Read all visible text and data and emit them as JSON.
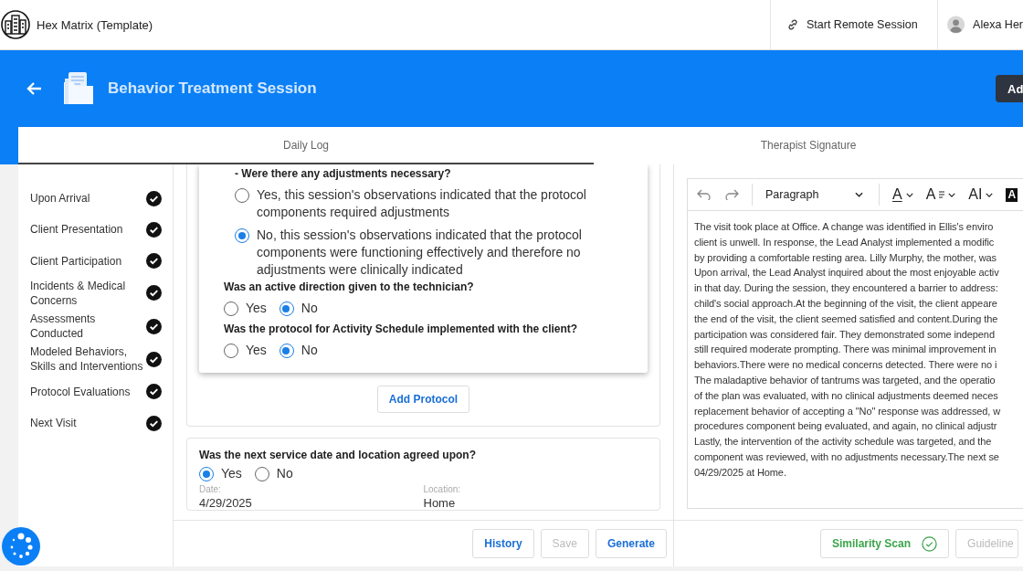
{
  "header": {
    "app_title": "Hex Matrix (Template)",
    "remote_session": "Start Remote Session",
    "user_name": "Alexa Her"
  },
  "banner": {
    "title": "Behavior Treatment Session",
    "action_button": "Ad"
  },
  "tabs": [
    {
      "label": "Daily Log",
      "selected": true
    },
    {
      "label": "Therapist Signature",
      "selected": false
    }
  ],
  "sidebar": {
    "items": [
      {
        "label": "Upon Arrival",
        "complete": true
      },
      {
        "label": "Client Presentation",
        "complete": true
      },
      {
        "label": "Client Participation",
        "complete": true
      },
      {
        "label": "Incidents & Medical Concerns",
        "complete": true
      },
      {
        "label": "Assessments Conducted",
        "complete": true
      },
      {
        "label": "Modeled Behaviors, Skills and Interventions",
        "complete": true
      },
      {
        "label": "Protocol Evaluations",
        "complete": true
      },
      {
        "label": "Next Visit",
        "complete": true
      }
    ]
  },
  "protocol_questions": [
    {
      "kind": "stacked",
      "text": "- Were there any adjustments necessary?",
      "options": [
        {
          "label": "Yes, this session's observations indicated that the protocol components required adjustments",
          "selected": false
        },
        {
          "label": "No, this session's observations indicated that the protocol components were functioning effectively and therefore no adjustments were clinically indicated",
          "selected": true
        }
      ]
    },
    {
      "kind": "inline",
      "text": "Was an active direction given to the technician?",
      "options": [
        {
          "label": "Yes",
          "selected": false
        },
        {
          "label": "No",
          "selected": true
        }
      ]
    },
    {
      "kind": "inline",
      "text": "Was the protocol for Activity Schedule implemented with the client?",
      "options": [
        {
          "label": "Yes",
          "selected": false
        },
        {
          "label": "No",
          "selected": true
        }
      ]
    }
  ],
  "add_protocol_button": "Add Protocol",
  "next_visit": {
    "question": "Was the next service date and location agreed upon?",
    "options": [
      {
        "label": "Yes",
        "selected": true
      },
      {
        "label": "No",
        "selected": false
      }
    ],
    "date_label": "Date:",
    "date_value": "4/29/2025",
    "location_label": "Location:",
    "location_value": "Home"
  },
  "action_buttons": [
    {
      "label": "History",
      "disabled": false
    },
    {
      "label": "Save",
      "disabled": true
    },
    {
      "label": "Generate",
      "disabled": false
    }
  ],
  "editor": {
    "block_format": "Paragraph",
    "format_buttons": [
      {
        "kind": "font-color",
        "glyph": "A"
      },
      {
        "kind": "font-size",
        "glyph": "A"
      },
      {
        "kind": "font-family",
        "glyph": "AI"
      },
      {
        "kind": "highlight",
        "glyph": "A"
      }
    ],
    "lines": [
      "The visit took place at Office. A change was identified in Ellis's enviro",
      "client is unwell. In response, the Lead Analyst implemented a modific",
      "by providing a comfortable resting area. Lilly Murphy, the mother, was",
      "Upon arrival, the Lead Analyst inquired about the most enjoyable activ",
      "in that day. During the session, they encountered a barrier to address:",
      "child's social approach.At the beginning of the visit, the client appeare",
      "the end of the visit, the client seemed satisfied and content.During the",
      "participation was considered fair. They demonstrated some independ",
      "still required moderate prompting. There was minimal improvement in",
      "behaviors.There were no medical concerns detected. There were no i",
      "The maladaptive behavior of tantrums was targeted, and the operatio",
      "of the plan was evaluated, with no clinical adjustments deemed neces",
      "replacement behavior of accepting a \"No\" response was addressed, w",
      "procedures component being evaluated, and again, no clinical adjustr",
      "Lastly, the intervention of the activity schedule was targeted, and the",
      "component was reviewed, with no adjustments necessary.The next se",
      "04/29/2025 at Home."
    ]
  },
  "editor_buttons": [
    {
      "label": "Similarity Scan",
      "kind": "scan",
      "disabled": false
    },
    {
      "label": "Guideline",
      "kind": "plain",
      "disabled": true
    }
  ]
}
